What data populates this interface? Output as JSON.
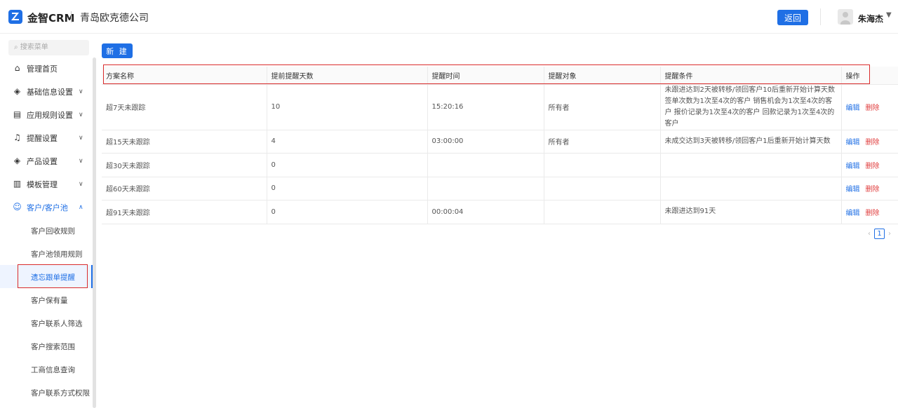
{
  "header": {
    "brand": "金智CRM",
    "company": "青岛欧克德公司",
    "back_label": "返回",
    "username": "朱海杰"
  },
  "sidebar": {
    "search_placeholder": "搜索菜单",
    "items": [
      {
        "label": "管理首页",
        "icon": "home-icon"
      },
      {
        "label": "基础信息设置",
        "icon": "cube-icon"
      },
      {
        "label": "应用规则设置",
        "icon": "document-icon"
      },
      {
        "label": "提醒设置",
        "icon": "bell-icon"
      },
      {
        "label": "产品设置",
        "icon": "cube-icon"
      },
      {
        "label": "模板管理",
        "icon": "template-icon"
      },
      {
        "label": "客户/客户池",
        "icon": "users-icon"
      }
    ],
    "sub_items": [
      {
        "label": "客户回收规则"
      },
      {
        "label": "客户池领用规则"
      },
      {
        "label": "遗忘跟单提醒"
      },
      {
        "label": "客户保有量"
      },
      {
        "label": "客户联系人筛选"
      },
      {
        "label": "客户搜索范围"
      },
      {
        "label": "工商信息查询"
      },
      {
        "label": "客户联系方式权限"
      }
    ]
  },
  "toolbar": {
    "new_label": "新 建"
  },
  "table": {
    "headers": [
      "方案名称",
      "提前提醒天数",
      "提醒时间",
      "提醒对象",
      "提醒条件",
      "操作"
    ],
    "edit_label": "编辑",
    "delete_label": "删除",
    "rows": [
      [
        "超7天未跟踪",
        "10",
        "15:20:16",
        "所有者",
        "未跟进达到2天被转移/领回客户10后重新开始计算天数 签单次数为1次至4次的客户 销售机会为1次至4次的客户 报价记录为1次至4次的客户 回款记录为1次至4次的客户"
      ],
      [
        "超15天未跟踪",
        "4",
        "03:00:00",
        "所有者",
        "未成交达到3天被转移/领回客户1后重新开始计算天数"
      ],
      [
        "超30天未跟踪",
        "0",
        "",
        "",
        ""
      ],
      [
        "超60天未跟踪",
        "0",
        "",
        "",
        ""
      ],
      [
        "超91天未跟踪",
        "0",
        "00:00:04",
        "",
        "未跟进达到91天"
      ]
    ]
  },
  "pagination": {
    "current_page": "1"
  }
}
